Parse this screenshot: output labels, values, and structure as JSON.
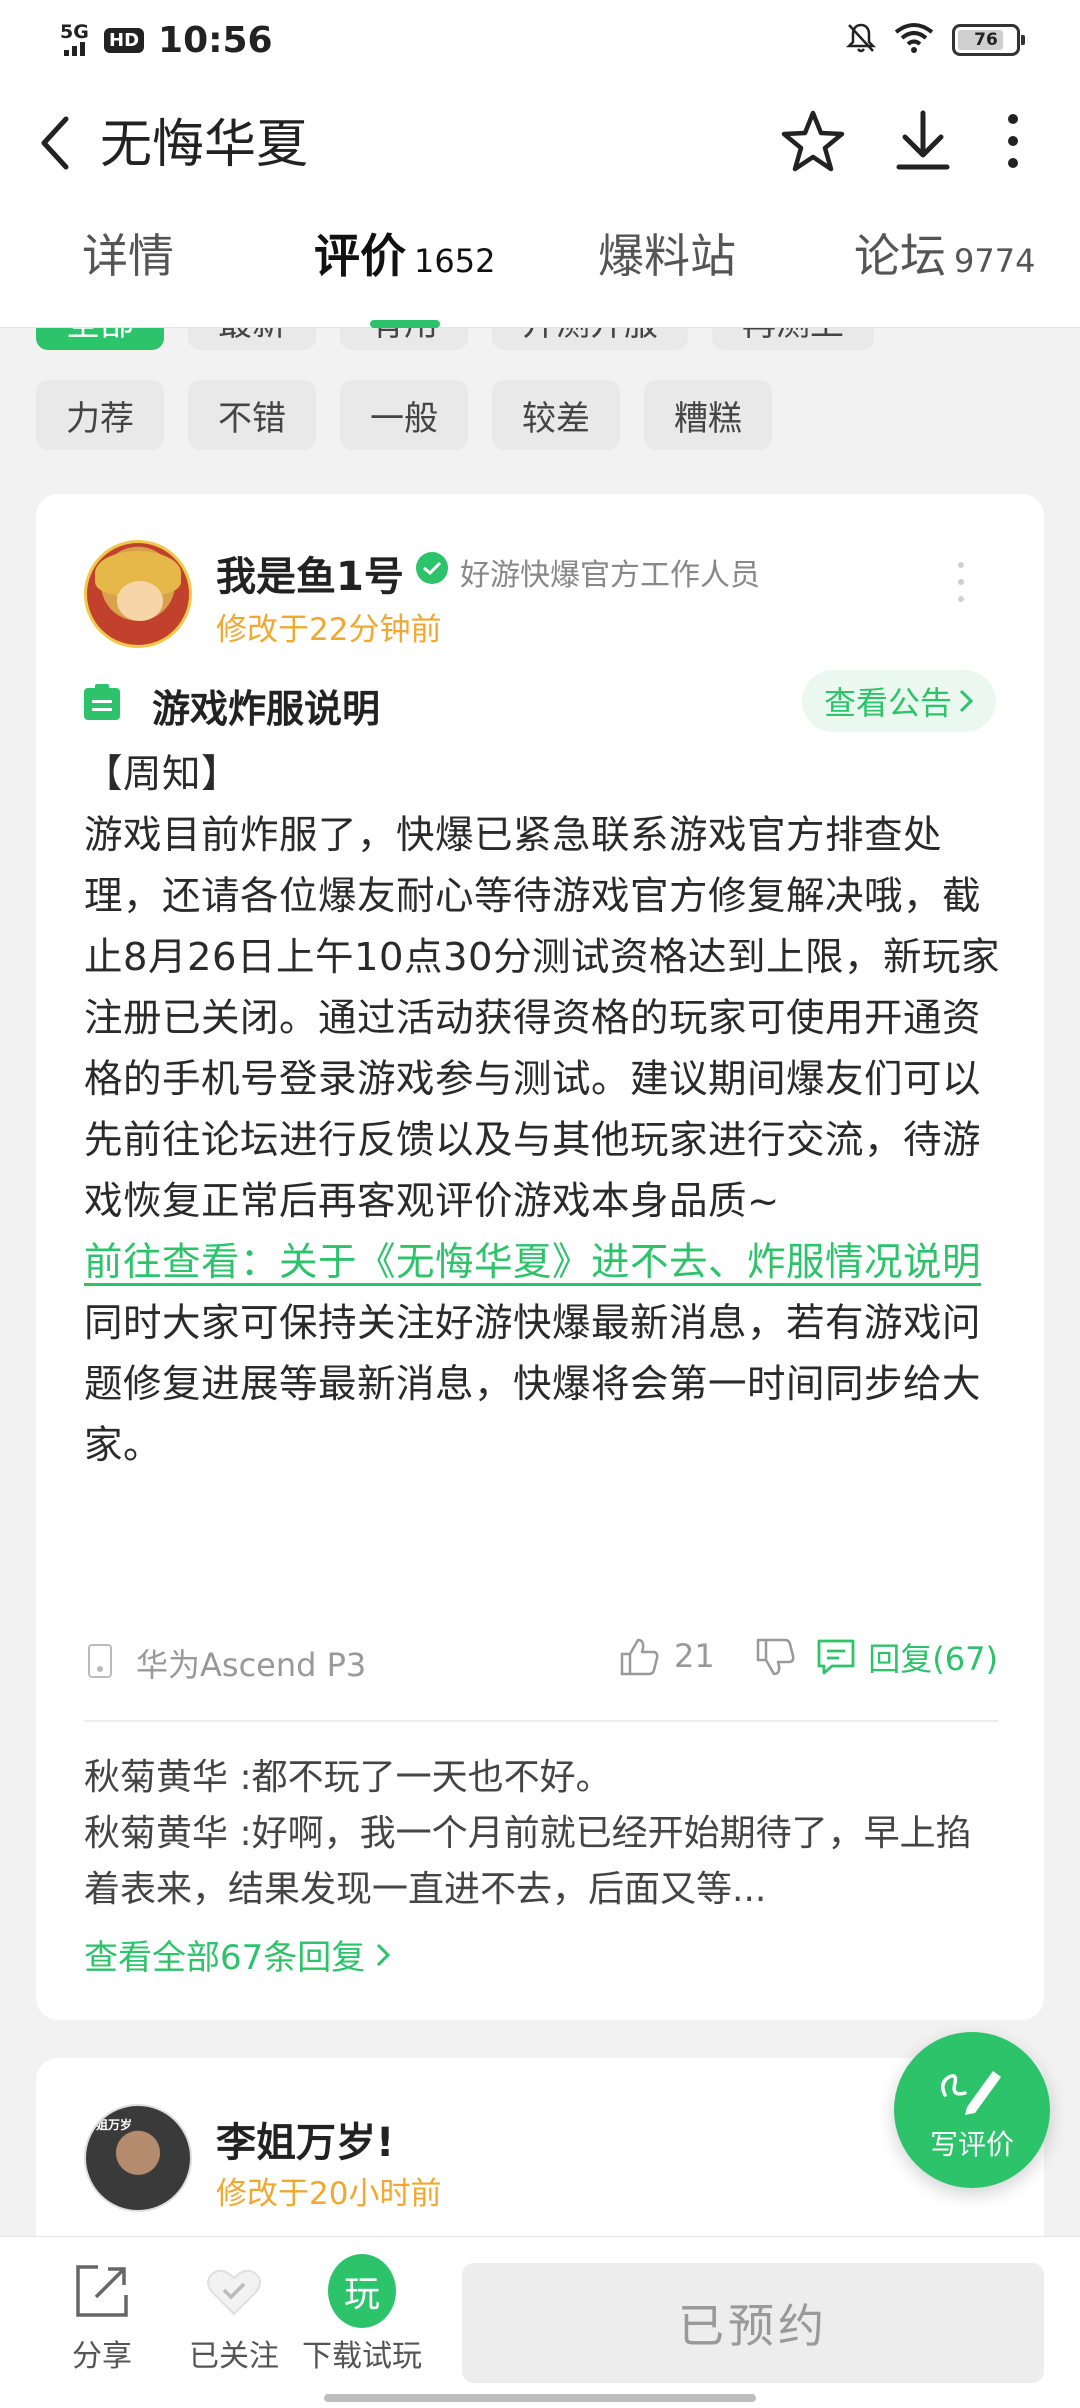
{
  "status_bar": {
    "network": "5G",
    "hd": "HD",
    "time": "10:56",
    "battery": "76"
  },
  "header": {
    "title": "无悔华夏"
  },
  "tabs": [
    {
      "label": "详情",
      "count": ""
    },
    {
      "label": "评价",
      "count": "1652"
    },
    {
      "label": "爆料站",
      "count": ""
    },
    {
      "label": "论坛",
      "count": "9774"
    }
  ],
  "filters": {
    "row1_partial": [
      "全部",
      "最新",
      "有用",
      "开测开服",
      "再测上"
    ],
    "row2": [
      "力荐",
      "不错",
      "一般",
      "较差",
      "糟糕"
    ],
    "active": "全部"
  },
  "review": {
    "username": "我是鱼1号",
    "role": "好游快爆官方工作人员",
    "edited": "修改于22分钟前",
    "notice_title": "游戏炸服说明",
    "notice_button": "查看公告",
    "paragraphs": [
      "【周知】",
      "游戏目前炸服了，快爆已紧急联系游戏官方排查处理，还请各位爆友耐心等待游戏官方修复解决哦，截止8月26日上午10点30分测试资格达到上限，新玩家注册已关闭。通过活动获得资格的玩家可使用开通资格的手机号登录游戏参与测试。建议期间爆友们可以先前往论坛进行反馈以及与其他玩家进行交流，待游戏恢复正常后再客观评价游戏本身品质~"
    ],
    "link": "前往查看：关于《无悔华夏》进不去、炸服情况说明",
    "closing": "同时大家可保持关注好游快爆最新消息，若有游戏问题修复进展等最新消息，快爆将会第一时间同步给大家。",
    "device": "华为Ascend P3",
    "likes": "21",
    "reply_label": "回复(67)",
    "replies": [
      {
        "name": "秋菊黄华",
        "text": "都不玩了一天也不好。"
      },
      {
        "name": "秋菊黄华",
        "text": "好啊，我一个月前就已经开始期待了，早上掐着表来，结果发现一直进不去，后面又等..."
      }
    ],
    "view_all": "查看全部67条回复"
  },
  "review2": {
    "username": "李姐万岁!",
    "edited": "修改于20小时前",
    "avatar_text": "姐万岁"
  },
  "fab": {
    "label": "写评价"
  },
  "bottom_bar": {
    "share": "分享",
    "follow": "已关注",
    "play_icon": "玩",
    "download": "下载试玩",
    "reserved": "已预约"
  },
  "colors": {
    "accent": "#2cc36b",
    "time_orange": "#f0a830"
  }
}
